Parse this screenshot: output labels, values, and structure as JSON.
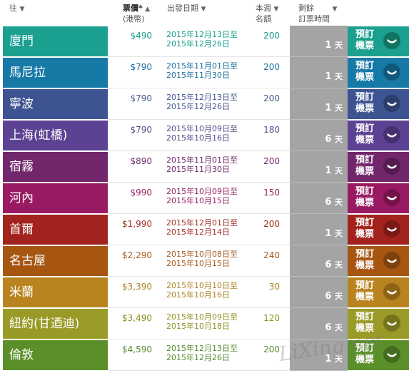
{
  "header": {
    "to_label": "往",
    "price_label": "票價*",
    "price_sub": "(港幣)",
    "date_label": "出發日期",
    "quota_label_1": "本週",
    "quota_label_2": "名額",
    "remaining_label_1": "剩餘",
    "remaining_label_2": "訂票時間",
    "sort_down": "▼",
    "sort_up": "▲"
  },
  "book_line1": "預訂",
  "book_line2": "機票",
  "day_unit": "天",
  "watermark": "LiXing.net",
  "colors": {
    "remaining_bg": "#a4a4a4"
  },
  "rows": [
    {
      "dest": "廈門",
      "price": "$490",
      "date_from": "2015年12月13日至",
      "date_to": "2015年12月26日",
      "quota": "200",
      "days": "1",
      "color": "#1b9f8f",
      "btn_color": "#10745f",
      "text_color": "#179c8b"
    },
    {
      "dest": "馬尼拉",
      "price": "$790",
      "date_from": "2015年11月01日至",
      "date_to": "2015年11月30日",
      "quota": "200",
      "days": "1",
      "color": "#1779a6",
      "btn_color": "#0f587c",
      "text_color": "#1c6ea0"
    },
    {
      "dest": "寧波",
      "price": "$790",
      "date_from": "2015年12月13日至",
      "date_to": "2015年12月26日",
      "quota": "200",
      "days": "1",
      "color": "#3e5492",
      "btn_color": "#2c3d6e",
      "text_color": "#44548e"
    },
    {
      "dest": "上海(虹橋)",
      "price": "$790",
      "date_from": "2015年10月09日至",
      "date_to": "2015年10月16日",
      "quota": "180",
      "days": "6",
      "color": "#5d4293",
      "btn_color": "#463070",
      "text_color": "#5c4a8c"
    },
    {
      "dest": "宿霧",
      "price": "$890",
      "date_from": "2015年11月01日至",
      "date_to": "2015年11月30日",
      "quota": "200",
      "days": "1",
      "color": "#72276c",
      "btn_color": "#561c52",
      "text_color": "#6d2d6a"
    },
    {
      "dest": "河內",
      "price": "$990",
      "date_from": "2015年10月09日至",
      "date_to": "2015年10月15日",
      "quota": "150",
      "days": "6",
      "color": "#991a62",
      "btn_color": "#741249",
      "text_color": "#93245f"
    },
    {
      "dest": "首爾",
      "price": "$1,990",
      "date_from": "2015年12月01日至",
      "date_to": "2015年12月14日",
      "quota": "200",
      "days": "1",
      "color": "#a2231d",
      "btn_color": "#7a1915",
      "text_color": "#a03025"
    },
    {
      "dest": "名古屋",
      "price": "$2,290",
      "date_from": "2015年10月08日至",
      "date_to": "2015年10月15日",
      "quota": "240",
      "days": "6",
      "color": "#a65611",
      "btn_color": "#7e410c",
      "text_color": "#a35a1e"
    },
    {
      "dest": "米蘭",
      "price": "$3,390",
      "date_from": "2015年10月10日至",
      "date_to": "2015年10月16日",
      "quota": "30",
      "days": "6",
      "color": "#b9841f",
      "btn_color": "#8c6416",
      "text_color": "#ad8428"
    },
    {
      "dest": "紐約(甘迺迪)",
      "price": "$3,490",
      "date_from": "2015年10月09日至",
      "date_to": "2015年10月18日",
      "quota": "120",
      "days": "6",
      "color": "#9a9a28",
      "btn_color": "#74741c",
      "text_color": "#8f9026"
    },
    {
      "dest": "倫敦",
      "price": "$4,590",
      "date_from": "2015年12月13日至",
      "date_to": "2015年12月26日",
      "quota": "200",
      "days": "1",
      "color": "#5b8f2a",
      "btn_color": "#446c1f",
      "text_color": "#558c2f"
    }
  ]
}
